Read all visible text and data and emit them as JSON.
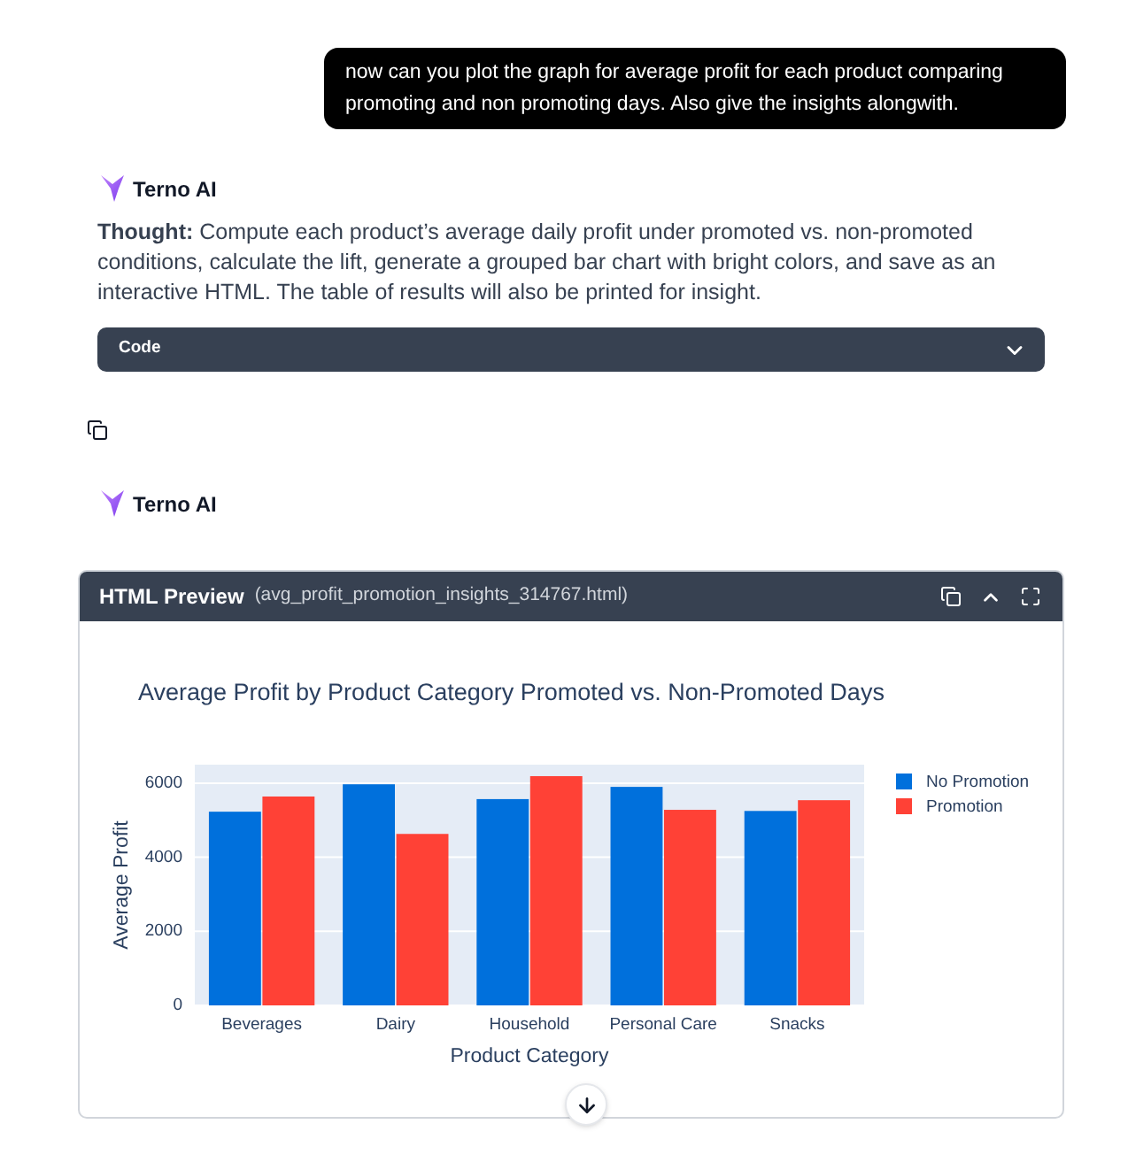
{
  "user_message": {
    "text": "now can you plot the graph for average profit for each product comparing promoting and non promoting days. Also give the insights alongwith."
  },
  "responses": [
    {
      "kind": "thought",
      "author": "Terno AI",
      "thought": "**Thought:** Compute each product’s average daily profit under promoted vs. non-promoted conditions, calculate the lift, generate a grouped bar chart with bright colors, and save as an interactive HTML. The table of results will also be printed for insight.",
      "code_panel": {
        "label": "Code",
        "expanded": false
      }
    },
    {
      "kind": "preview",
      "author": "Terno AI",
      "preview": {
        "title": "HTML Preview",
        "filename": "(avg_profit_promotion_insights_314767.html)",
        "expanded": true,
        "chart_data": {
          "type": "bar",
          "title": "Average Profit by Product Category Promoted vs. Non-Promoted Days",
          "xlabel": "Product Category",
          "ylabel": "Average Profit",
          "categories": [
            "Beverages",
            "Dairy",
            "Household",
            "Personal Care",
            "Snacks"
          ],
          "series": [
            {
              "name": "No Promotion",
              "color": "#0070dc",
              "values": [
                5230,
                5970,
                5570,
                5900,
                5250
              ]
            },
            {
              "name": "Promotion",
              "color": "#ff4136",
              "values": [
                5640,
                4630,
                6190,
                5280,
                5540
              ]
            }
          ],
          "ylim": [
            0,
            6500
          ],
          "yticks": [
            0,
            2000,
            4000,
            6000
          ],
          "grid": true,
          "legend": true
        }
      }
    }
  ]
}
